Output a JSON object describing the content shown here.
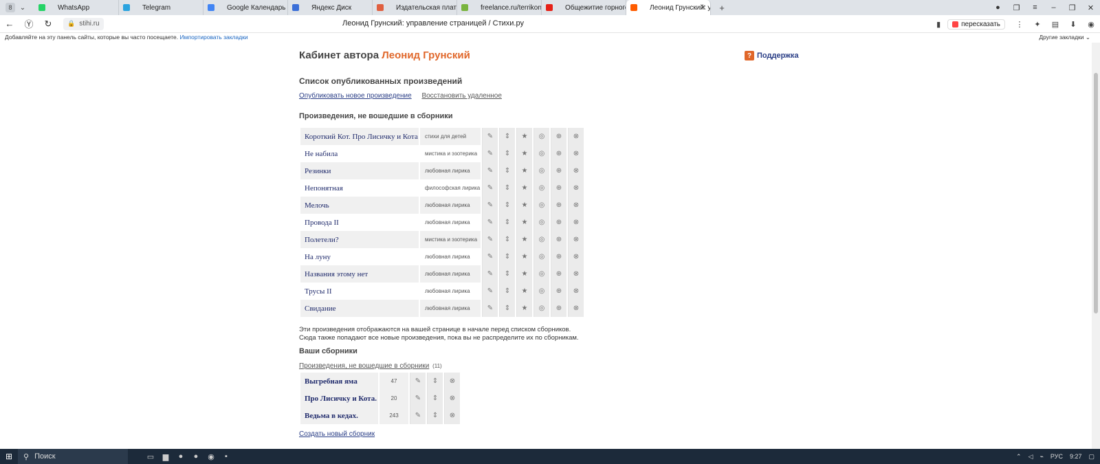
{
  "browser": {
    "tab_counter": "8",
    "tabs": [
      {
        "label": "WhatsApp",
        "color": "#25d366"
      },
      {
        "label": "Telegram",
        "color": "#2aa3df"
      },
      {
        "label": "Google Календарь - Неде",
        "color": "#4285f4"
      },
      {
        "label": "Яндекс Диск",
        "color": "#3b6fd8"
      },
      {
        "label": "Издательская платформ",
        "color": "#e06040"
      },
      {
        "label": "freelance.ru/terrikons/?cm",
        "color": "#79b43e"
      },
      {
        "label": "Общежитие горного техн",
        "color": "#e62117"
      },
      {
        "label": "Леонид Грунский: упра",
        "color": "#ff5c00"
      }
    ],
    "url": "stihi.ru",
    "page_title": "Леонид Грунский: управление страницей / Стихи.ру",
    "retell_label": "пересказать",
    "bookmark_hint": "Добавляйте на эту панель сайты, которые вы часто посещаете.",
    "bookmark_import": "Импортировать закладки",
    "other_bookmarks": "Другие закладки"
  },
  "cabinet": {
    "title_prefix": "Кабинет автора",
    "author": "Леонид Грунский",
    "support_icon": "?",
    "support": "Поддержка"
  },
  "published": {
    "heading": "Список опубликованных произведений",
    "publish_new": "Опубликовать новое произведение",
    "restore_deleted": "Восстановить удаленное"
  },
  "uncollected": {
    "heading": "Произведения, не вошедшие в сборники",
    "works": [
      {
        "title": "Короткий Кот. Про Лисичку и Кота",
        "category": "стихи для детей"
      },
      {
        "title": "Не набила",
        "category": "мистика и эзотерика"
      },
      {
        "title": "Резинки",
        "category": "любовная лирика"
      },
      {
        "title": "Непонятная",
        "category": "философская лирика"
      },
      {
        "title": "Мелочь",
        "category": "любовная лирика"
      },
      {
        "title": "Провода II",
        "category": "любовная лирика"
      },
      {
        "title": "Полетели?",
        "category": "мистика и эзотерика"
      },
      {
        "title": "На луну",
        "category": "любовная лирика"
      },
      {
        "title": "Названия этому нет",
        "category": "любовная лирика"
      },
      {
        "title": "Трусы II",
        "category": "любовная лирика"
      },
      {
        "title": "Свидание",
        "category": "любовная лирика"
      }
    ],
    "note_line1": "Эти произведения отображаются на вашей странице в начале перед списком сборников.",
    "note_line2": "Сюда также попадают все новые произведения, пока вы не распределите их по сборникам."
  },
  "collections": {
    "heading": "Ваши сборники",
    "uncollected_link": "Произведения, не вошедшие в сборники",
    "uncollected_count": "(11)",
    "items": [
      {
        "title": "Выгребная яма",
        "count": "47"
      },
      {
        "title": "Про Лисичку и Кота.",
        "count": "20"
      },
      {
        "title": "Ведьма в кедах.",
        "count": "243"
      }
    ],
    "create_new": "Создать новый сборник"
  },
  "taskbar": {
    "search": "Поиск",
    "lang": "РУС",
    "time": "9:27"
  }
}
